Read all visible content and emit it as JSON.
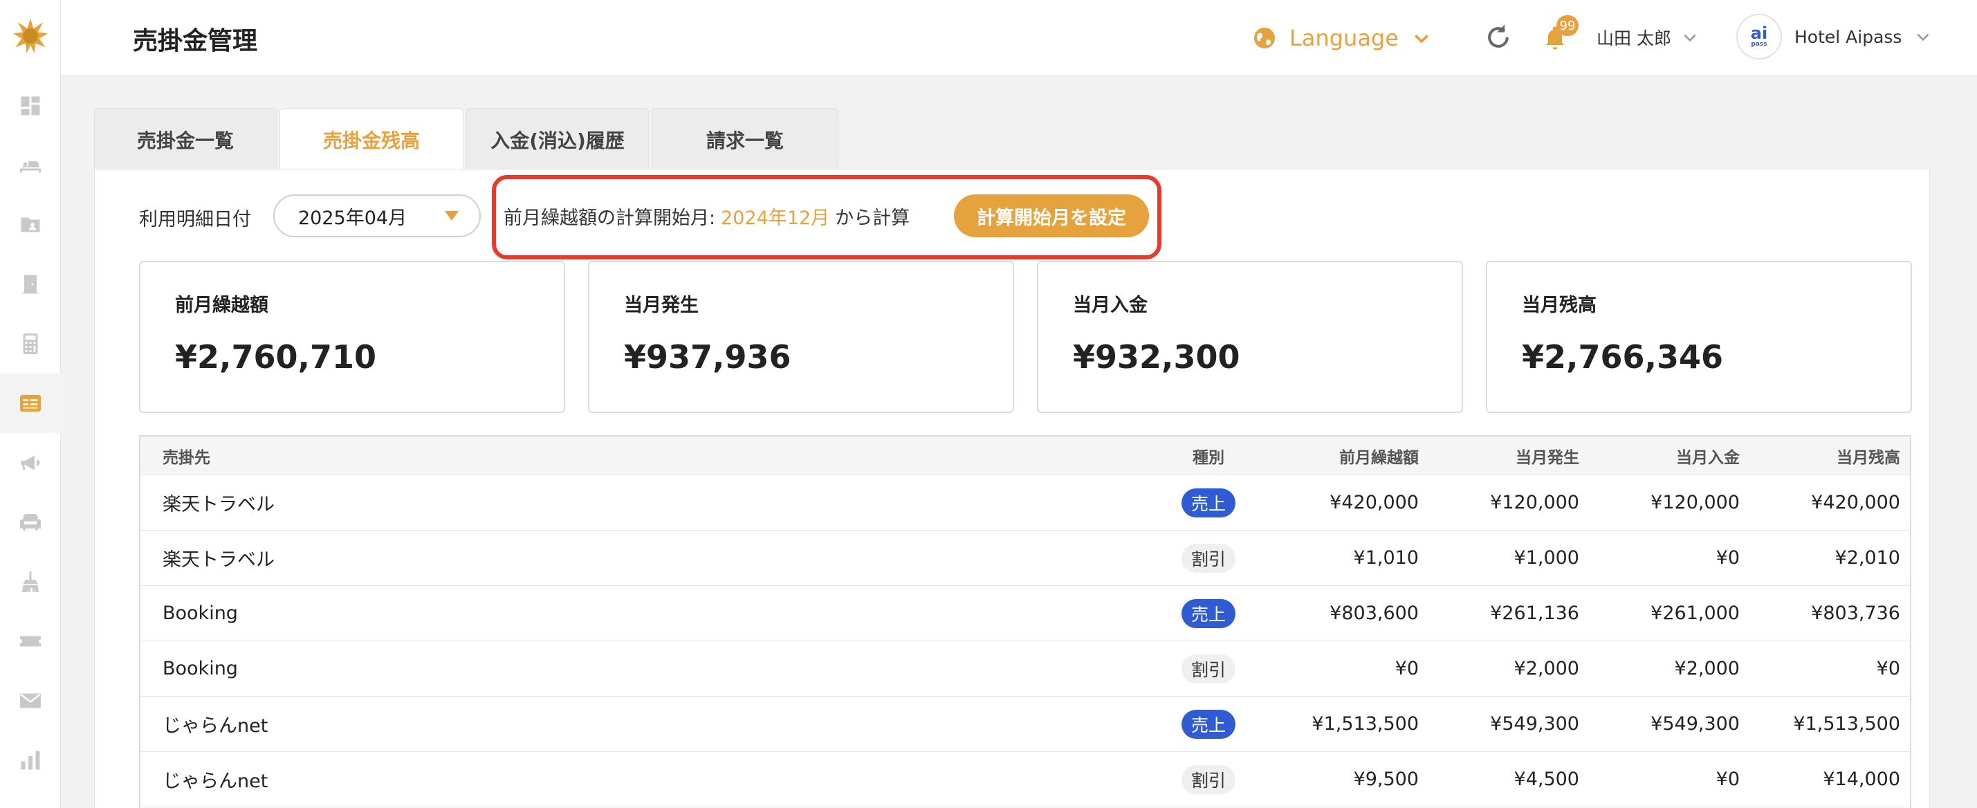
{
  "colors": {
    "accent": "#e6a23c",
    "sale_tag": "#2f5bd3",
    "highlight": "#e8392b"
  },
  "sidebar": {
    "items": [
      {
        "icon": "dashboard-icon"
      },
      {
        "icon": "bed-icon"
      },
      {
        "icon": "folder-person-icon"
      },
      {
        "icon": "door-icon"
      },
      {
        "icon": "calculator-icon"
      },
      {
        "icon": "receivables-icon",
        "active": true
      },
      {
        "icon": "megaphone-icon"
      },
      {
        "icon": "sofa-icon"
      },
      {
        "icon": "broom-icon"
      },
      {
        "icon": "ticket-icon"
      },
      {
        "icon": "mail-icon"
      },
      {
        "icon": "bar-chart-icon"
      }
    ]
  },
  "header": {
    "title": "売掛金管理",
    "language_label": "Language",
    "notification_count": "99",
    "user_name": "山田 太郎",
    "hotel_name": "Hotel Aipass",
    "avatar_top": "ai",
    "avatar_bottom": "pass"
  },
  "tabs": [
    {
      "label": "売掛金一覧"
    },
    {
      "label": "売掛金残高",
      "active": true
    },
    {
      "label": "入金(消込)履歴"
    },
    {
      "label": "請求一覧"
    }
  ],
  "filter": {
    "label": "利用明細日付",
    "selected_month": "2025年04月",
    "start_prefix": "前月繰越額の計算開始月:",
    "start_month": "2024年12月",
    "start_suffix": "から計算",
    "set_button": "計算開始月を設定"
  },
  "summary": [
    {
      "label": "前月繰越額",
      "value": "¥2,760,710"
    },
    {
      "label": "当月発生",
      "value": "¥937,936"
    },
    {
      "label": "当月入金",
      "value": "¥932,300"
    },
    {
      "label": "当月残高",
      "value": "¥2,766,346"
    }
  ],
  "table": {
    "headers": {
      "name": "売掛先",
      "type": "種別",
      "prev": "前月繰越額",
      "gen": "当月発生",
      "in": "当月入金",
      "bal": "当月残高"
    },
    "rows": [
      {
        "name": "楽天トラベル",
        "type": "売上",
        "kind": "sale",
        "prev": "¥420,000",
        "gen": "¥120,000",
        "in": "¥120,000",
        "bal": "¥420,000"
      },
      {
        "name": "楽天トラベル",
        "type": "割引",
        "kind": "disc",
        "prev": "¥1,010",
        "gen": "¥1,000",
        "in": "¥0",
        "bal": "¥2,010"
      },
      {
        "name": "Booking",
        "type": "売上",
        "kind": "sale",
        "prev": "¥803,600",
        "gen": "¥261,136",
        "in": "¥261,000",
        "bal": "¥803,736"
      },
      {
        "name": "Booking",
        "type": "割引",
        "kind": "disc",
        "prev": "¥0",
        "gen": "¥2,000",
        "in": "¥2,000",
        "bal": "¥0"
      },
      {
        "name": "じゃらんnet",
        "type": "売上",
        "kind": "sale",
        "prev": "¥1,513,500",
        "gen": "¥549,300",
        "in": "¥549,300",
        "bal": "¥1,513,500"
      },
      {
        "name": "じゃらんnet",
        "type": "割引",
        "kind": "disc",
        "prev": "¥9,500",
        "gen": "¥4,500",
        "in": "¥0",
        "bal": "¥14,000"
      }
    ]
  }
}
